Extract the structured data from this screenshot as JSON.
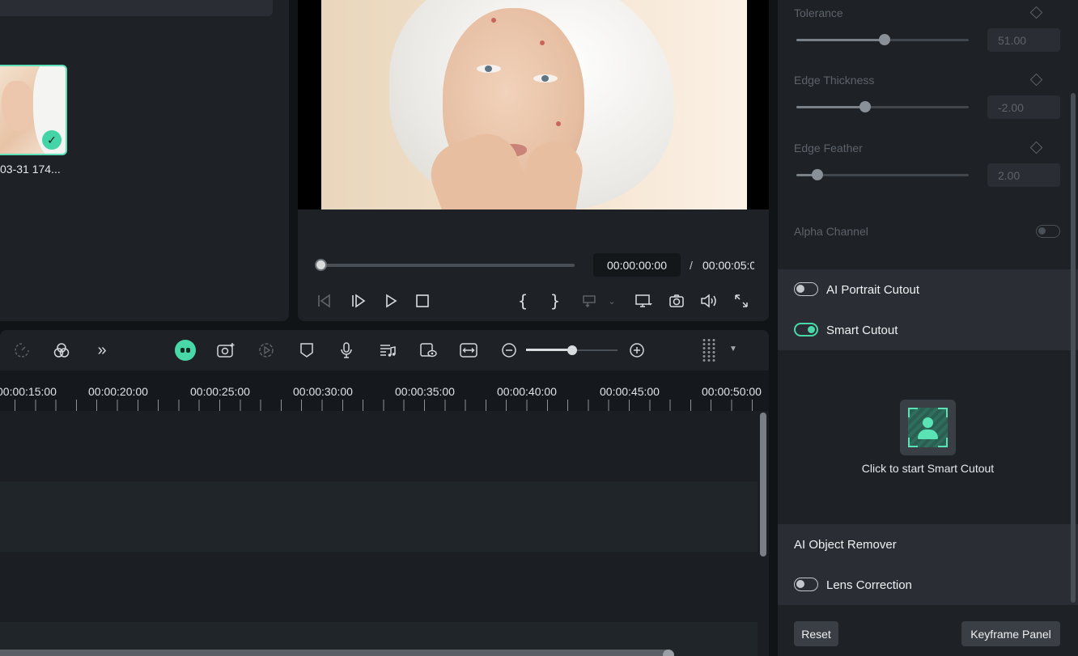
{
  "media": {
    "clip_caption": "03-31 174..."
  },
  "preview": {
    "current_time": "00:00:00:00",
    "separator": "/",
    "total_time": "00:00:05:00"
  },
  "timeline": {
    "ruler_labels": [
      "00:00:15:00",
      "00:00:20:00",
      "00:00:25:00",
      "00:00:30:00",
      "00:00:35:00",
      "00:00:40:00",
      "00:00:45:00",
      "00:00:50:00"
    ],
    "zoom_level": 0.5
  },
  "properties": {
    "tolerance": {
      "label": "Tolerance",
      "value": "51.00",
      "level": 0.51
    },
    "edge_thickness": {
      "label": "Edge Thickness",
      "value": "-2.00",
      "level": 0.4
    },
    "edge_feather": {
      "label": "Edge Feather",
      "value": "2.00",
      "level": 0.12
    },
    "alpha_channel": {
      "label": "Alpha Channel"
    },
    "ai_portrait_cutout": {
      "label": "AI Portrait Cutout",
      "enabled": false
    },
    "smart_cutout": {
      "label": "Smart Cutout",
      "enabled": true,
      "hint": "Click to start Smart Cutout"
    },
    "ai_object_remover": {
      "label": "AI Object Remover"
    },
    "lens_correction": {
      "label": "Lens Correction",
      "enabled": false
    },
    "reset_label": "Reset",
    "keyframe_panel_label": "Keyframe Panel"
  },
  "colors": {
    "accent": "#49d9a9",
    "panel": "#1e2227",
    "section": "#2a2e34"
  }
}
